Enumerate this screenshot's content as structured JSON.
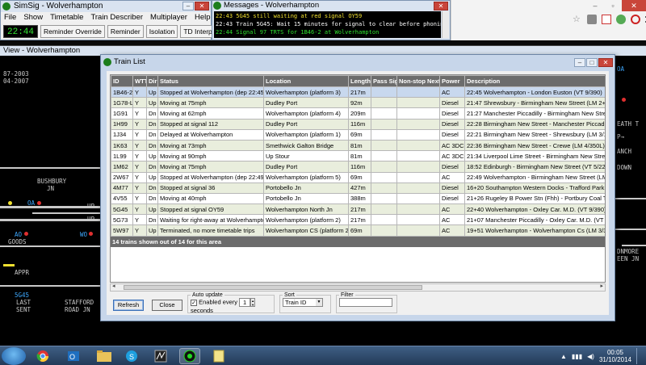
{
  "simsig": {
    "title": "SimSig - Wolverhampton",
    "menu": [
      "File",
      "Show",
      "Timetable",
      "Train Describer",
      "Multiplayer",
      "Help"
    ],
    "clock": "22:44",
    "buttons": [
      "Reminder Override",
      "Reminder",
      "Isolation",
      "TD Interpose"
    ]
  },
  "messages": {
    "title": "Messages - Wolverhampton",
    "lines": [
      {
        "text": "22:43 5G45 still waiting at red signal OY59",
        "color": "#f0e030"
      },
      {
        "text": "22:43 Train 5G45: Wait 15 minutes for signal to clear before phoning",
        "color": "#ffffff"
      },
      {
        "text": "22:44 Signal 97 TRTS for 1B46-2 at Wolverhampton",
        "color": "#30e030"
      }
    ]
  },
  "view": {
    "title": "View - Wolverhampton",
    "labels_left": [
      "87-2003",
      "04-2007",
      "BUSHBURY",
      "JN",
      "GOODS",
      "APPR",
      "5G45",
      "LAST",
      "SENT",
      "STAFFORD",
      "ROAD JN",
      "UP-",
      "UP-",
      "OA",
      "AO",
      "WO"
    ],
    "labels_right": [
      "OA",
      "EATH T",
      "P→",
      "ANCH",
      "DOWN",
      "DNMORE",
      "EEN JN"
    ]
  },
  "train_list": {
    "title": "Train List",
    "columns": [
      "ID",
      "WTT",
      "Dir",
      "Status",
      "Location",
      "Length",
      "Pass Sig",
      "Non-stop Next",
      "Power",
      "Description"
    ],
    "rows": [
      [
        "1B46-2",
        "Y",
        "Up",
        "Stopped at Wolverhampton (dep 22:45)",
        "Wolverhampton (platform 3)",
        "217m",
        "",
        "",
        "AC",
        "22:45 Wolverhampton - London Euston (VT 9/390)"
      ],
      [
        "1G78-L",
        "Y",
        "Up",
        "Moving at 75mph",
        "Dudley Port",
        "92m",
        "",
        "",
        "Diesel",
        "21:47 Shrewsbury - Birmingham New Street (LM 2+2/1"
      ],
      [
        "1G91",
        "Y",
        "Dn",
        "Moving at 62mph",
        "Wolverhampton (platform 4)",
        "209m",
        "",
        "",
        "Diesel",
        "21:27 Manchester Piccadilly - Birmingham New Street"
      ],
      [
        "1H99",
        "Y",
        "Dn",
        "Stopped at signal 112",
        "Dudley Port",
        "116m",
        "",
        "",
        "Diesel",
        "22:28 Birmingham New Street - Manchester Piccadilly"
      ],
      [
        "1J34",
        "Y",
        "Dn",
        "Delayed at Wolverhampton",
        "Wolverhampton (platform 1)",
        "69m",
        "",
        "",
        "Diesel",
        "22:21 Birmingham New Street - Shrewsbury (LM 3/170"
      ],
      [
        "1K63",
        "Y",
        "Dn",
        "Moving at 73mph",
        "Smethwick Galton Bridge",
        "81m",
        "",
        "",
        "AC 3DC",
        "22:36 Birmingham New Street - Crewe (LM 4/350L)"
      ],
      [
        "1L99",
        "Y",
        "Up",
        "Moving at 90mph",
        "Up Stour",
        "81m",
        "",
        "",
        "AC 3DC",
        "21:34 Liverpool Lime Street - Birmingham New Street"
      ],
      [
        "1M62",
        "Y",
        "Dn",
        "Moving at 75mph",
        "Dudley Port",
        "116m",
        "",
        "",
        "Diesel",
        "18:52 Edinburgh - Birmingham New Street (VT 5/221)"
      ],
      [
        "2W67",
        "Y",
        "Up",
        "Stopped at Wolverhampton (dep 22:49)",
        "Wolverhampton (platform 5)",
        "69m",
        "",
        "",
        "AC",
        "22:49 Wolverhampton - Birmingham New Street (LM 3"
      ],
      [
        "4M77",
        "Y",
        "Dn",
        "Stopped at signal 36",
        "Portobello Jn",
        "427m",
        "",
        "",
        "Diesel",
        "16+20 Southampton Western Docks - Trafford Park Eu"
      ],
      [
        "4V55",
        "Y",
        "Dn",
        "Moving at 40mph",
        "Portobello Jn",
        "388m",
        "",
        "",
        "Diesel",
        "21+26 Rugeley B Power Stn (Fhh) - Portbury Coal Ter"
      ],
      [
        "5G45",
        "Y",
        "Up",
        "Stopped at signal OY59",
        "Wolverhampton North Jn",
        "217m",
        "",
        "",
        "AC",
        "22+40 Wolverhampton - Oxley Car. M.D. (VT 9/390)"
      ],
      [
        "5G73",
        "Y",
        "Dn",
        "Waiting for right-away at Wolverhampton",
        "Wolverhampton (platform 2)",
        "217m",
        "",
        "",
        "AC",
        "21+07 Manchester Piccadilly - Oxley Car. M.D. (VT 9/39"
      ],
      [
        "5W97",
        "Y",
        "Up",
        "Terminated, no more timetable trips",
        "Wolverhampton CS (platform 2)",
        "69m",
        "",
        "",
        "AC",
        "19+51 Wolverhampton - Wolverhampton Cs (LM 3/323"
      ]
    ],
    "summary": "14 trains shown out of 14 for this area",
    "refresh": "Refresh",
    "close": "Close",
    "auto_update_legend": "Auto update",
    "enabled_every": "Enabled every",
    "interval": "1",
    "seconds": "seconds",
    "sort_legend": "Sort",
    "sort_value": "Train ID",
    "filter_legend": "Filter"
  },
  "taskbar": {
    "time": "00:05",
    "date": "31/10/2014"
  }
}
